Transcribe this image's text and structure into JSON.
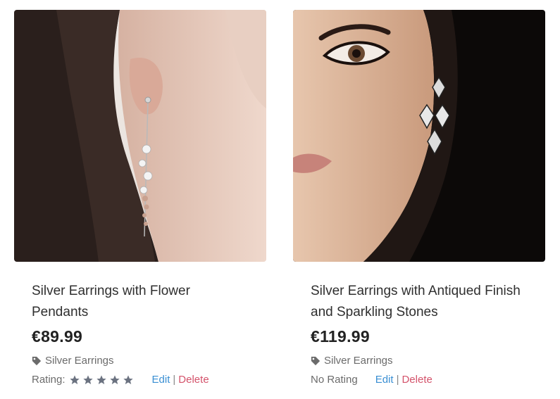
{
  "products": [
    {
      "title": "Silver Earrings with Flower Pendants",
      "price": "€89.99",
      "category": "Silver Earrings",
      "rating_label": "Rating:",
      "rating_stars": 5,
      "edit_label": "Edit",
      "separator": "|",
      "delete_label": "Delete",
      "icon": "tag-icon"
    },
    {
      "title": "Silver Earrings with Antiqued Finish and Sparkling Stones",
      "price": "€119.99",
      "category": "Silver Earrings",
      "rating_label": "No Rating",
      "rating_stars": 0,
      "edit_label": "Edit",
      "separator": "|",
      "delete_label": "Delete",
      "icon": "tag-icon"
    }
  ],
  "colors": {
    "edit_link": "#3a8fd3",
    "delete_link": "#d4536b",
    "star": "#6b7280",
    "muted_text": "#6b6b6b"
  }
}
